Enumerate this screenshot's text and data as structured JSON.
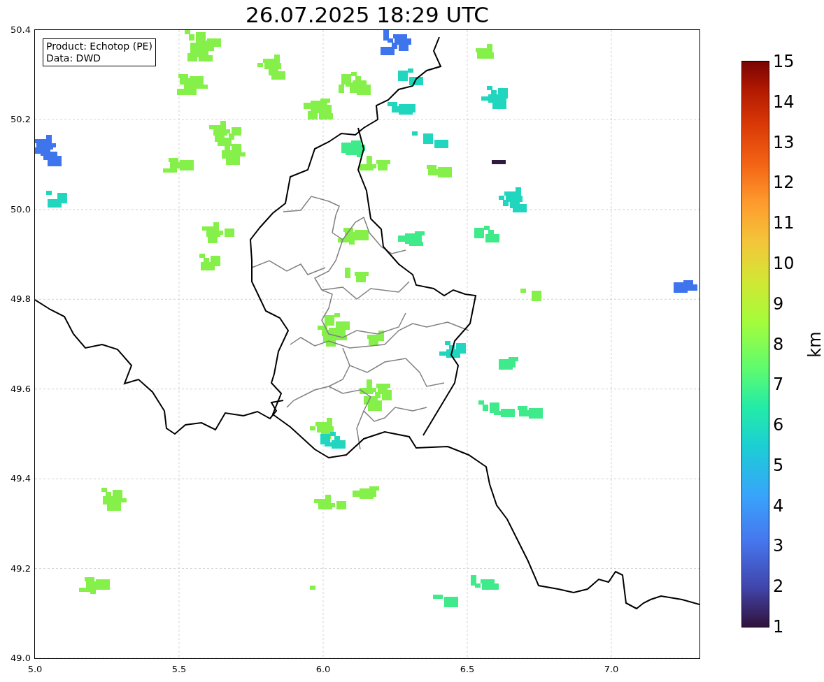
{
  "title": "26.07.2025 18:29 UTC",
  "legend": [
    "Product: Echotop (PE)",
    "Data: DWD"
  ],
  "map": {
    "kind": "map",
    "x_ticks": [
      "5.0",
      "5.5",
      "6.0",
      "6.5",
      "7.0"
    ],
    "y_ticks": [
      "50.4",
      "50.2",
      "50.0",
      "49.8",
      "49.6",
      "49.4",
      "49.2",
      "49.0"
    ]
  },
  "colorbar": {
    "label": "km",
    "ticks": [
      "15",
      "14",
      "13",
      "12",
      "11",
      "10",
      "9",
      "8",
      "7",
      "6",
      "5",
      "4",
      "3",
      "2",
      "1"
    ]
  }
}
